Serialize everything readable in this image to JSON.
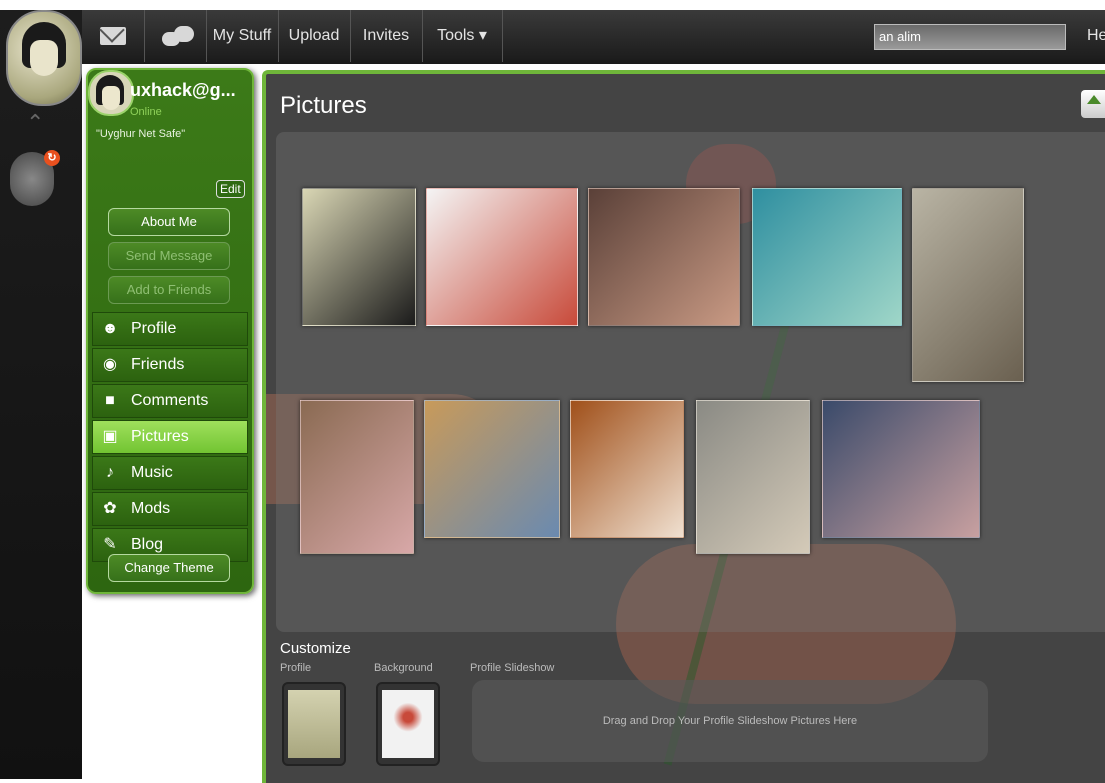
{
  "topbar": {
    "mail_icon": "mail-icon",
    "chat_icon": "chat-icon",
    "my_stuff": "My Stuff",
    "upload": "Upload",
    "invites": "Invites",
    "tools": "Tools ▾",
    "search_value": "an alim",
    "help": "He"
  },
  "rail": {
    "badge": "↻"
  },
  "profile": {
    "name": "uxhack@g...",
    "status": "Online",
    "quote": "\"Uyghur Net Safe\"",
    "edit": "Edit",
    "about_me": "About Me",
    "send_message": "Send Message",
    "add_to_friends": "Add to Friends",
    "change_theme": "Change Theme",
    "menu": [
      {
        "label": "Profile",
        "icon": "person-icon"
      },
      {
        "label": "Friends",
        "icon": "friends-icon"
      },
      {
        "label": "Comments",
        "icon": "comments-icon"
      },
      {
        "label": "Pictures",
        "icon": "camera-icon"
      },
      {
        "label": "Music",
        "icon": "headphones-icon"
      },
      {
        "label": "Mods",
        "icon": "mods-icon"
      },
      {
        "label": "Blog",
        "icon": "pencil-icon"
      }
    ],
    "active_menu": "Pictures"
  },
  "main": {
    "title": "Pictures",
    "customize": "Customize",
    "profile_label": "Profile",
    "background_label": "Background",
    "slideshow_label": "Profile Slideshow",
    "dropzone_text": "Drag and Drop Your Profile Slideshow Pictures Here"
  },
  "gallery": [
    {
      "name": "portrait-sketch",
      "colors": [
        "#d9d6b4",
        "#1b1b1b"
      ]
    },
    {
      "name": "hands-rose",
      "colors": [
        "#f4f4f4",
        "#c84a3a"
      ]
    },
    {
      "name": "woman-portrait",
      "colors": [
        "#5a4038",
        "#c99a84"
      ]
    },
    {
      "name": "fantasy-girl",
      "colors": [
        "#2f8fa0",
        "#9fd6c8"
      ]
    },
    {
      "name": "old-painting",
      "colors": [
        "#b9b4a4",
        "#6a6050"
      ]
    },
    {
      "name": "rose-carving",
      "colors": [
        "#8a6a52",
        "#d8a8a8"
      ]
    },
    {
      "name": "autumn-lake",
      "colors": [
        "#c89a5a",
        "#6a8ab0"
      ]
    },
    {
      "name": "abstract-fractal",
      "colors": [
        "#a0501a",
        "#f0e0d0"
      ]
    },
    {
      "name": "antiques",
      "colors": [
        "#8a8a84",
        "#d4cab8"
      ]
    },
    {
      "name": "mountain-statue",
      "colors": [
        "#3a4a6a",
        "#c8a0a0"
      ]
    }
  ],
  "colors": {
    "accent_green": "#6fb63a",
    "panel_green": "#3c7a18",
    "active_green": "#8fd44c"
  }
}
